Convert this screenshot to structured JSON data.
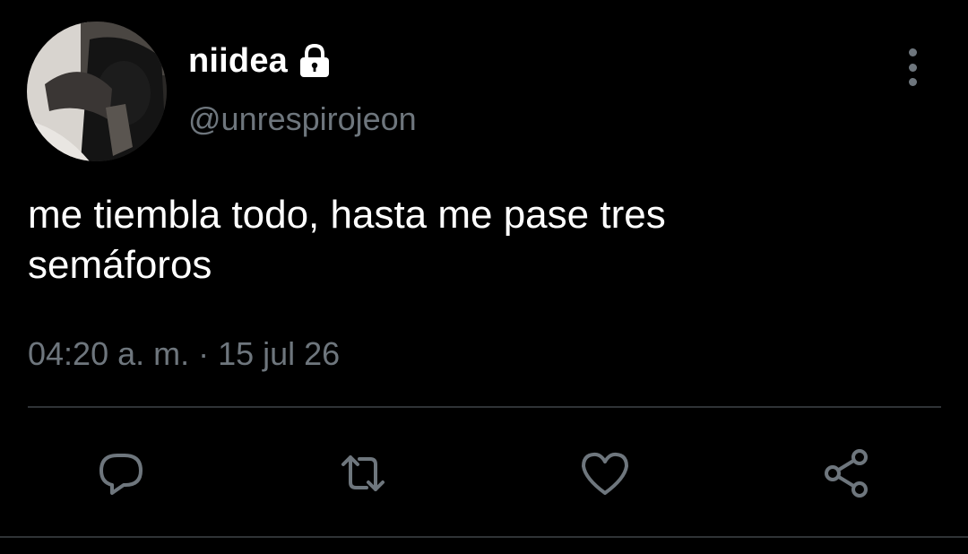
{
  "tweet": {
    "display_name": "niidea",
    "handle": "@unrespirojeon",
    "text": "me tiembla todo, hasta me pase tres\nsemáforos",
    "timestamp": "04:20 a. m. · 15 jul 26",
    "protected": true
  },
  "icons": {
    "lock": "lock-icon",
    "more": "more-vertical-icon",
    "reply": "reply-icon",
    "retweet": "retweet-icon",
    "like": "heart-icon",
    "share": "share-icon"
  },
  "colors": {
    "background": "#000000",
    "primary_text": "#ffffff",
    "secondary_text": "#6e767d",
    "divider": "#2f3336"
  }
}
